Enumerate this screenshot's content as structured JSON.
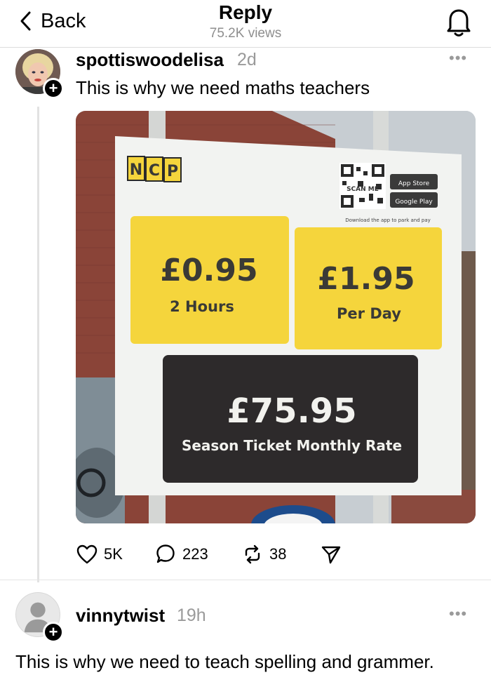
{
  "header": {
    "back_label": "Back",
    "title": "Reply",
    "views": "75.2K views",
    "notification_icon": "bell-icon"
  },
  "post": {
    "username": "spottiswoodelisa",
    "time": "2d",
    "more": "•••",
    "text": "This is why we need maths teachers",
    "follow_symbol": "+",
    "photo": {
      "brand": "NCP",
      "qr_caption": "Download the app to park and pay",
      "scan_me": "SCAN ME",
      "app_store": "App Store",
      "google_play": "Google Play",
      "price_1": "£0.95",
      "label_1": "2 Hours",
      "price_2": "£1.95",
      "label_2": "Per Day",
      "price_3": "£75.95",
      "label_3": "Season Ticket Monthly Rate"
    },
    "actions": {
      "likes": "5K",
      "comments": "223",
      "reposts": "38"
    }
  },
  "reply": {
    "username": "vinnytwist",
    "time": "19h",
    "more": "•••",
    "follow_symbol": "+",
    "text": "This is why we need to teach spelling and grammer."
  },
  "colors": {
    "sign_yellow": "#f5d53c",
    "sign_dark": "#2d2a2b",
    "brick": "#8a4438",
    "sky": "#c7cdd2"
  }
}
